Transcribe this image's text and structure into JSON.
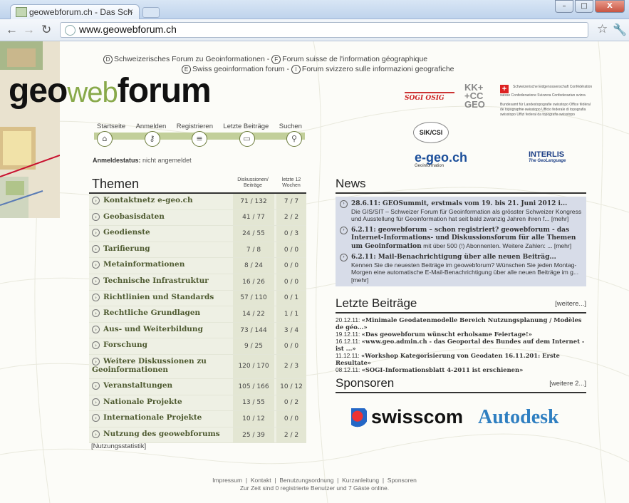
{
  "browser": {
    "tab_title": "geowebforum.ch - Das Sch",
    "tab_close": "×",
    "url": "www.geowebforum.ch",
    "win_min": "–",
    "win_max": "□",
    "win_close": "X"
  },
  "top_links": {
    "d_badge": "D",
    "d": "Schweizerisches Forum zu Geoinformationen",
    "sep": "-",
    "f_badge": "F",
    "f": "Forum suisse de l'information géographique",
    "e_badge": "E",
    "e": "Swiss geoinformation forum",
    "i_badge": "I",
    "i": "Forum svizzero sulle informazioni geografiche"
  },
  "logo": {
    "geo": "geo",
    "web": "web",
    "forum": "forum"
  },
  "menu": {
    "items": [
      "Startseite",
      "Anmelden",
      "Registrieren",
      "Letzte Beiträge",
      "Suchen"
    ]
  },
  "status": {
    "label": "Anmeldestatus:",
    "value": "nicht angemeldet"
  },
  "themen": {
    "title": "Themen",
    "col1": "Diskussionen/ Beiträge",
    "col2": "letzte 12 Wochen",
    "rows": [
      {
        "name": "Kontaktnetz e-geo.ch",
        "v1": "71 / 132",
        "v2": "7 / 7"
      },
      {
        "name": "Geobasisdaten",
        "v1": "41 / 77",
        "v2": "2 / 2"
      },
      {
        "name": "Geodienste",
        "v1": "24 / 55",
        "v2": "0 / 3"
      },
      {
        "name": "Tarifierung",
        "v1": "7 / 8",
        "v2": "0 / 0"
      },
      {
        "name": "Metainformationen",
        "v1": "8 / 24",
        "v2": "0 / 0"
      },
      {
        "name": "Technische Infrastruktur",
        "v1": "16 / 26",
        "v2": "0 / 0"
      },
      {
        "name": "Richtlinien und Standards",
        "v1": "57 / 110",
        "v2": "0 / 1"
      },
      {
        "name": "Rechtliche Grundlagen",
        "v1": "14 / 22",
        "v2": "1 / 1"
      },
      {
        "name": "Aus- und Weiterbildung",
        "v1": "73 / 144",
        "v2": "3 / 4"
      },
      {
        "name": "Forschung",
        "v1": "9 / 25",
        "v2": "0 / 0"
      },
      {
        "name": "Weitere Diskussionen zu Geoinformationen",
        "v1": "120 / 170",
        "v2": "2 / 3"
      },
      {
        "name": "Veranstaltungen",
        "v1": "105 / 166",
        "v2": "10 / 12"
      },
      {
        "name": "Nationale Projekte",
        "v1": "13 / 55",
        "v2": "0 / 2"
      },
      {
        "name": "Internationale Projekte",
        "v1": "10 / 12",
        "v2": "0 / 0"
      },
      {
        "name": "Nutzung des geowebforums",
        "v1": "25 / 39",
        "v2": "2 / 2"
      }
    ],
    "stats_link": "[Nutzungsstatistik]"
  },
  "partners": {
    "sogi": "SOGI OSIG",
    "kkgc": [
      "KK+",
      "+CC",
      "GEO"
    ],
    "swiss_cross": "+",
    "swissgov": "Schweizerische Eidgenossenschaft Confédération suisse Confederazione Svizzera Confederaziun svizra",
    "swisstopo": "Bundesamt für Landestopografie swisstopo Office fédéral de topographie swisstopo Ufficio federale di topografia swisstopo Uffizi federal da topografia swisstopo",
    "sik": "SIK/CSI",
    "egeo": "e-geo.ch",
    "egeo_sub": "Geoinformation",
    "interlis": "INTERLIS",
    "interlis_sub": "The GeoLanguage"
  },
  "news": {
    "title": "News",
    "items": [
      {
        "headline": "28.6.11: GEOSummit, erstmals vom 19. bis 21. Juni 2012 i...",
        "text": "Die GIS/SIT – Schweizer Forum für Geoinformation als grösster Schweizer Kongress und Ausstellung für Geoinformation hat seit bald zwanzig Jahren ihren f... [mehr]"
      },
      {
        "headline": "6.2.11: geowebforum – schon registriert? geowebforum - das Internet-Informations- und Diskussionsforum für alle Themen um Geoinformation",
        "text": "mit über 500 (!) Abonnenten. Weitere Zahlen: ... [mehr]"
      },
      {
        "headline": "6.2.11: Mail-Benachrichtigung über alle neuen Beiträg...",
        "text": "Kennen Sie die neuesten Beiträge im geowebforum? Wünschen Sie jeden Montag-Morgen eine automatische E-Mail-Benachrichtigung über alle neuen Beiträge im g... [mehr]"
      }
    ]
  },
  "letzte": {
    "title": "Letzte Beiträge",
    "more": "[weitere...]",
    "items": [
      {
        "date": "20.12.11:",
        "text": "«Minimale Geodatenmodelle Bereich Nutzungsplanung / Modèles de géo...»"
      },
      {
        "date": "19.12.11:",
        "text": "«Das geowebforum wünscht erholsame Feiertage!»"
      },
      {
        "date": "16.12.11:",
        "text": "«www.geo.admin.ch - das Geoportal des Bundes auf dem Internet - ist ...»"
      },
      {
        "date": "11.12.11:",
        "text": "«Workshop Kategorisierung von Geodaten 16.11.201: Erste Resultate»"
      },
      {
        "date": "08.12.11:",
        "text": "«SOGI-Informationsblatt 4-2011 ist erschienen»"
      }
    ]
  },
  "sponsoren": {
    "title": "Sponsoren",
    "more": "[weitere 2...]",
    "swisscom": "swisscom",
    "autodesk": "Autodesk"
  },
  "footer": {
    "links": [
      "Impressum",
      "Kontakt",
      "Benutzungsordnung",
      "Kurzanleitung",
      "Sponsoren"
    ],
    "sep": "|",
    "online": "Zur Zeit sind 0 registrierte Benutzer und 7 Gäste online."
  }
}
